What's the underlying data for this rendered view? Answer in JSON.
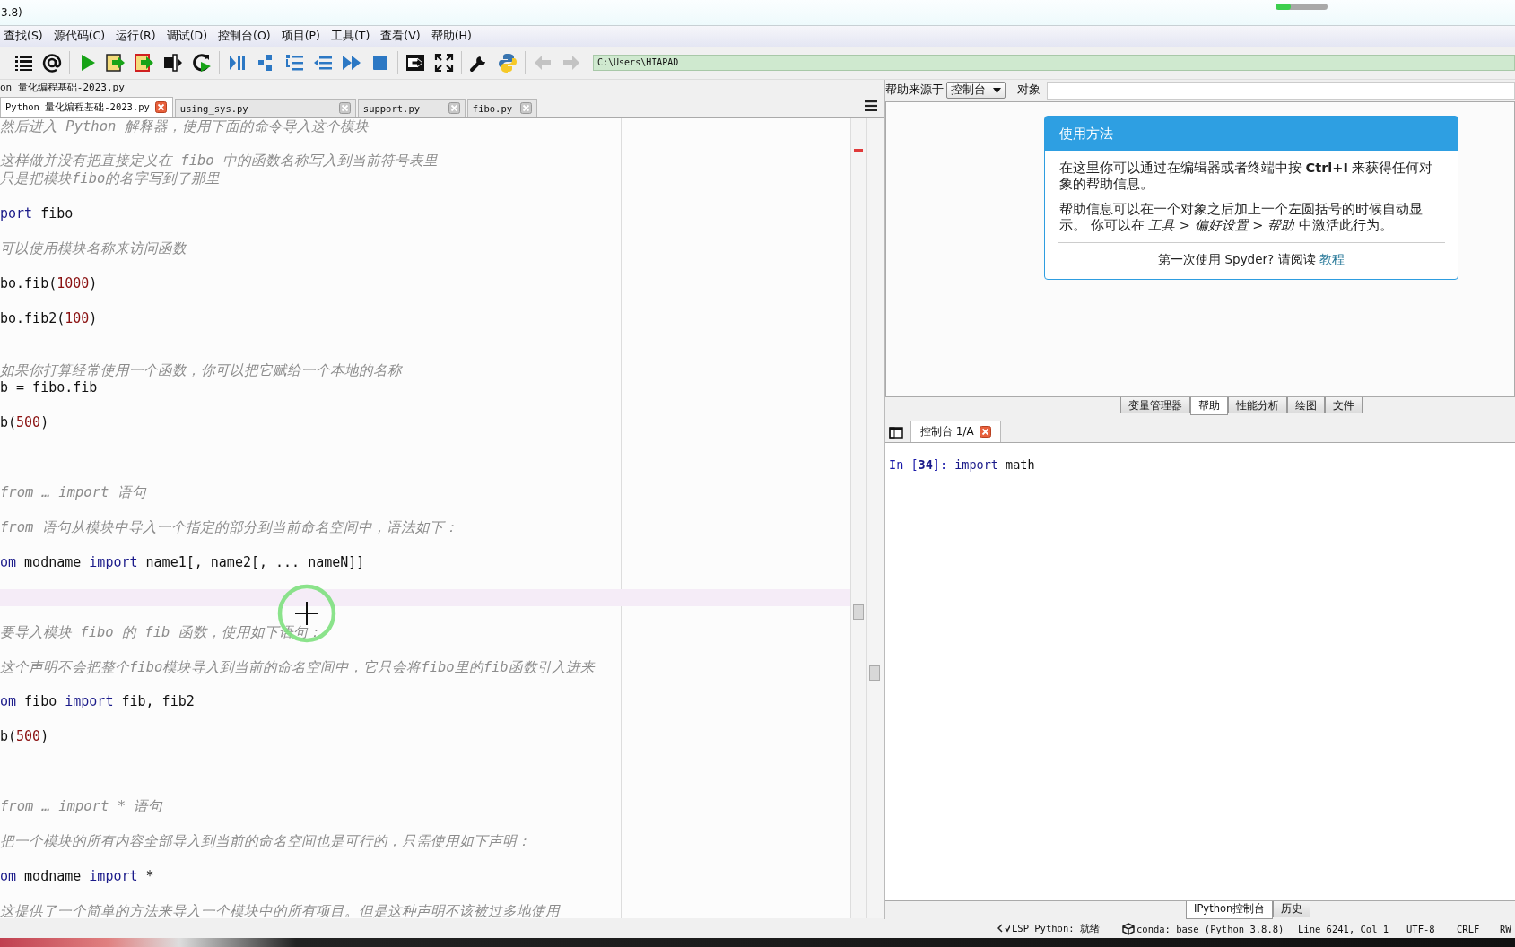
{
  "window": {
    "title": "3.8)",
    "indicator": {
      "level": 0.3
    }
  },
  "menu": [
    "查找(S)",
    "源代码(C)",
    "运行(R)",
    "调试(D)",
    "控制台(O)",
    "项目(P)",
    "工具(T)",
    "查看(V)",
    "帮助(H)"
  ],
  "toolbar": {
    "back": {
      "disabled": true
    },
    "forward": {
      "disabled": true
    },
    "path": "C:\\Users\\HIAPAD"
  },
  "editor": {
    "file_path": "on 量化编程基础-2023.py",
    "tabs": [
      {
        "label": "Python 量化编程基础-2023.py",
        "selected": true
      },
      {
        "label": "using_sys.py",
        "selected": false
      },
      {
        "label": "support.py",
        "selected": false
      },
      {
        "label": "fibo.py",
        "selected": false
      }
    ],
    "lines": [
      {
        "kind": "comment",
        "text": "然后进入 Python 解释器，使用下面的命令导入这个模块",
        "current": false
      },
      {
        "kind": "blank",
        "current": false
      },
      {
        "kind": "comment",
        "text": "这样做并没有把直接定义在 fibo 中的函数名称写入到当前符号表里",
        "current": false
      },
      {
        "kind": "comment",
        "text": "只是把模块fibo的名字写到了那里",
        "current": false
      },
      {
        "kind": "blank",
        "current": false
      },
      {
        "kind": "code",
        "tokens": [
          {
            "kind": "keyword",
            "text": "port"
          },
          {
            "kind": "plain",
            "text": " fibo"
          }
        ],
        "current": false
      },
      {
        "kind": "blank",
        "current": false
      },
      {
        "kind": "comment",
        "text": "可以使用模块名称来访问函数",
        "current": false
      },
      {
        "kind": "blank",
        "current": false
      },
      {
        "kind": "code",
        "tokens": [
          {
            "kind": "plain",
            "text": "bo.fib("
          },
          {
            "kind": "number",
            "text": "1000"
          },
          {
            "kind": "plain",
            "text": ")"
          }
        ],
        "current": false
      },
      {
        "kind": "blank",
        "current": false
      },
      {
        "kind": "code",
        "tokens": [
          {
            "kind": "plain",
            "text": "bo.fib2("
          },
          {
            "kind": "number",
            "text": "100"
          },
          {
            "kind": "plain",
            "text": ")"
          }
        ],
        "current": false
      },
      {
        "kind": "blank",
        "current": false
      },
      {
        "kind": "blank",
        "current": false
      },
      {
        "kind": "comment",
        "text": "如果你打算经常使用一个函数，你可以把它赋给一个本地的名称",
        "current": false
      },
      {
        "kind": "code",
        "tokens": [
          {
            "kind": "plain",
            "text": "b = fibo.fib"
          }
        ],
        "current": false
      },
      {
        "kind": "blank",
        "current": false
      },
      {
        "kind": "code",
        "tokens": [
          {
            "kind": "plain",
            "text": "b("
          },
          {
            "kind": "number",
            "text": "500"
          },
          {
            "kind": "plain",
            "text": ")"
          }
        ],
        "current": false
      },
      {
        "kind": "blank",
        "current": false
      },
      {
        "kind": "blank",
        "current": false
      },
      {
        "kind": "blank",
        "current": false
      },
      {
        "kind": "comment",
        "text": "from … import 语句",
        "current": false
      },
      {
        "kind": "blank",
        "current": false
      },
      {
        "kind": "comment",
        "text": "from 语句从模块中导入一个指定的部分到当前命名空间中，语法如下：",
        "current": false
      },
      {
        "kind": "blank",
        "current": false
      },
      {
        "kind": "code",
        "tokens": [
          {
            "kind": "keyword",
            "text": "om"
          },
          {
            "kind": "plain",
            "text": " modname "
          },
          {
            "kind": "keyword",
            "text": "import"
          },
          {
            "kind": "plain",
            "text": " name1[, name2[, ... nameN]]"
          }
        ],
        "current": false
      },
      {
        "kind": "blank",
        "current": false
      },
      {
        "kind": "blank",
        "current": true
      },
      {
        "kind": "blank",
        "current": false
      },
      {
        "kind": "comment",
        "text": "要导入模块 fibo 的 fib 函数，使用如下语句：",
        "current": false
      },
      {
        "kind": "blank",
        "current": false
      },
      {
        "kind": "comment",
        "text": "这个声明不会把整个fibo模块导入到当前的命名空间中，它只会将fibo里的fib函数引入进来",
        "current": false
      },
      {
        "kind": "blank",
        "current": false
      },
      {
        "kind": "code",
        "tokens": [
          {
            "kind": "keyword",
            "text": "om"
          },
          {
            "kind": "plain",
            "text": " fibo "
          },
          {
            "kind": "keyword",
            "text": "import"
          },
          {
            "kind": "plain",
            "text": " fib, fib2"
          }
        ],
        "current": false
      },
      {
        "kind": "blank",
        "current": false
      },
      {
        "kind": "code",
        "tokens": [
          {
            "kind": "plain",
            "text": "b("
          },
          {
            "kind": "number",
            "text": "500"
          },
          {
            "kind": "plain",
            "text": ")"
          }
        ],
        "current": false
      },
      {
        "kind": "blank",
        "current": false
      },
      {
        "kind": "blank",
        "current": false
      },
      {
        "kind": "blank",
        "current": false
      },
      {
        "kind": "comment",
        "text": "from … import * 语句",
        "current": false
      },
      {
        "kind": "blank",
        "current": false
      },
      {
        "kind": "comment",
        "text": "把一个模块的所有内容全部导入到当前的命名空间也是可行的，只需使用如下声明：",
        "current": false
      },
      {
        "kind": "blank",
        "current": false
      },
      {
        "kind": "code",
        "tokens": [
          {
            "kind": "keyword",
            "text": "om"
          },
          {
            "kind": "plain",
            "text": " modname "
          },
          {
            "kind": "keyword",
            "text": "import"
          },
          {
            "kind": "plain",
            "text": " *"
          }
        ],
        "current": false
      },
      {
        "kind": "blank",
        "current": false
      },
      {
        "kind": "comment",
        "text": "这提供了一个简单的方法来导入一个模块中的所有项目。但是这种声明不该被过多地使用",
        "current": false
      }
    ]
  },
  "help": {
    "source_label": "帮助来源于",
    "source_value": "控制台",
    "object_label": "对象",
    "card": {
      "title": "使用方法",
      "paragraphs": [
        "在这里你可以通过在编辑器或者终端中按 **Ctrl+I** 来获得任何对象的帮助信息。",
        "帮助信息可以在一个对象之后加上一个左圆括号的时候自动显示。 你可以在 *工具* > *偏好设置* > *帮助* 中激活此行为。"
      ],
      "footer": "第一次使用 Spyder? 请阅读",
      "footer_link": "教程"
    }
  },
  "pane_tabs": [
    {
      "label": "变量管理器",
      "selected": false
    },
    {
      "label": "帮助",
      "selected": true
    },
    {
      "label": "性能分析",
      "selected": false
    },
    {
      "label": "绘图",
      "selected": false
    },
    {
      "label": "文件",
      "selected": false
    }
  ],
  "console": {
    "tabs": [
      {
        "label": "控制台 1/A",
        "selected": true
      }
    ],
    "lines": [
      {
        "tokens": [
          {
            "kind": "prompt",
            "text": "In ["
          },
          {
            "kind": "prompt_number",
            "text": "34"
          },
          {
            "kind": "prompt",
            "text": "]: "
          },
          {
            "kind": "keyword",
            "text": "import"
          },
          {
            "kind": "plain",
            "text": " math"
          }
        ]
      }
    ]
  },
  "bottom_tabs": [
    {
      "label": "IPython控制台",
      "selected": true
    },
    {
      "label": "历史",
      "selected": false
    }
  ],
  "status_bar": [
    {
      "kind": "lsp",
      "text": "LSP Python: 就绪"
    },
    {
      "kind": "conda",
      "text": "conda: base (Python 3.8.8)"
    },
    {
      "kind": "plain",
      "text": "Line 6241, Col 1"
    },
    {
      "kind": "plain",
      "text": "UTF-8"
    },
    {
      "kind": "plain",
      "text": "CRLF"
    },
    {
      "kind": "plain",
      "text": "RW"
    }
  ]
}
